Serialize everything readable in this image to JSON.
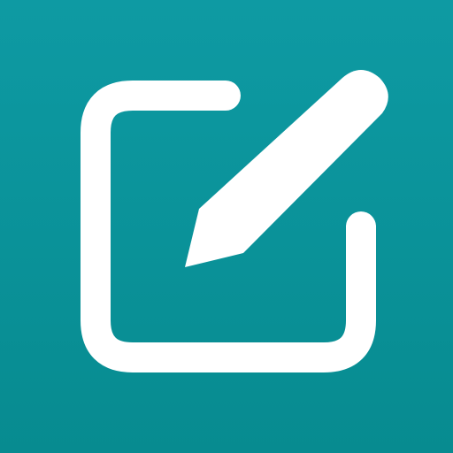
{
  "icon": {
    "name": "edit-note-icon",
    "background_color": "#0A8F95",
    "foreground_color": "#FFFFFF"
  }
}
